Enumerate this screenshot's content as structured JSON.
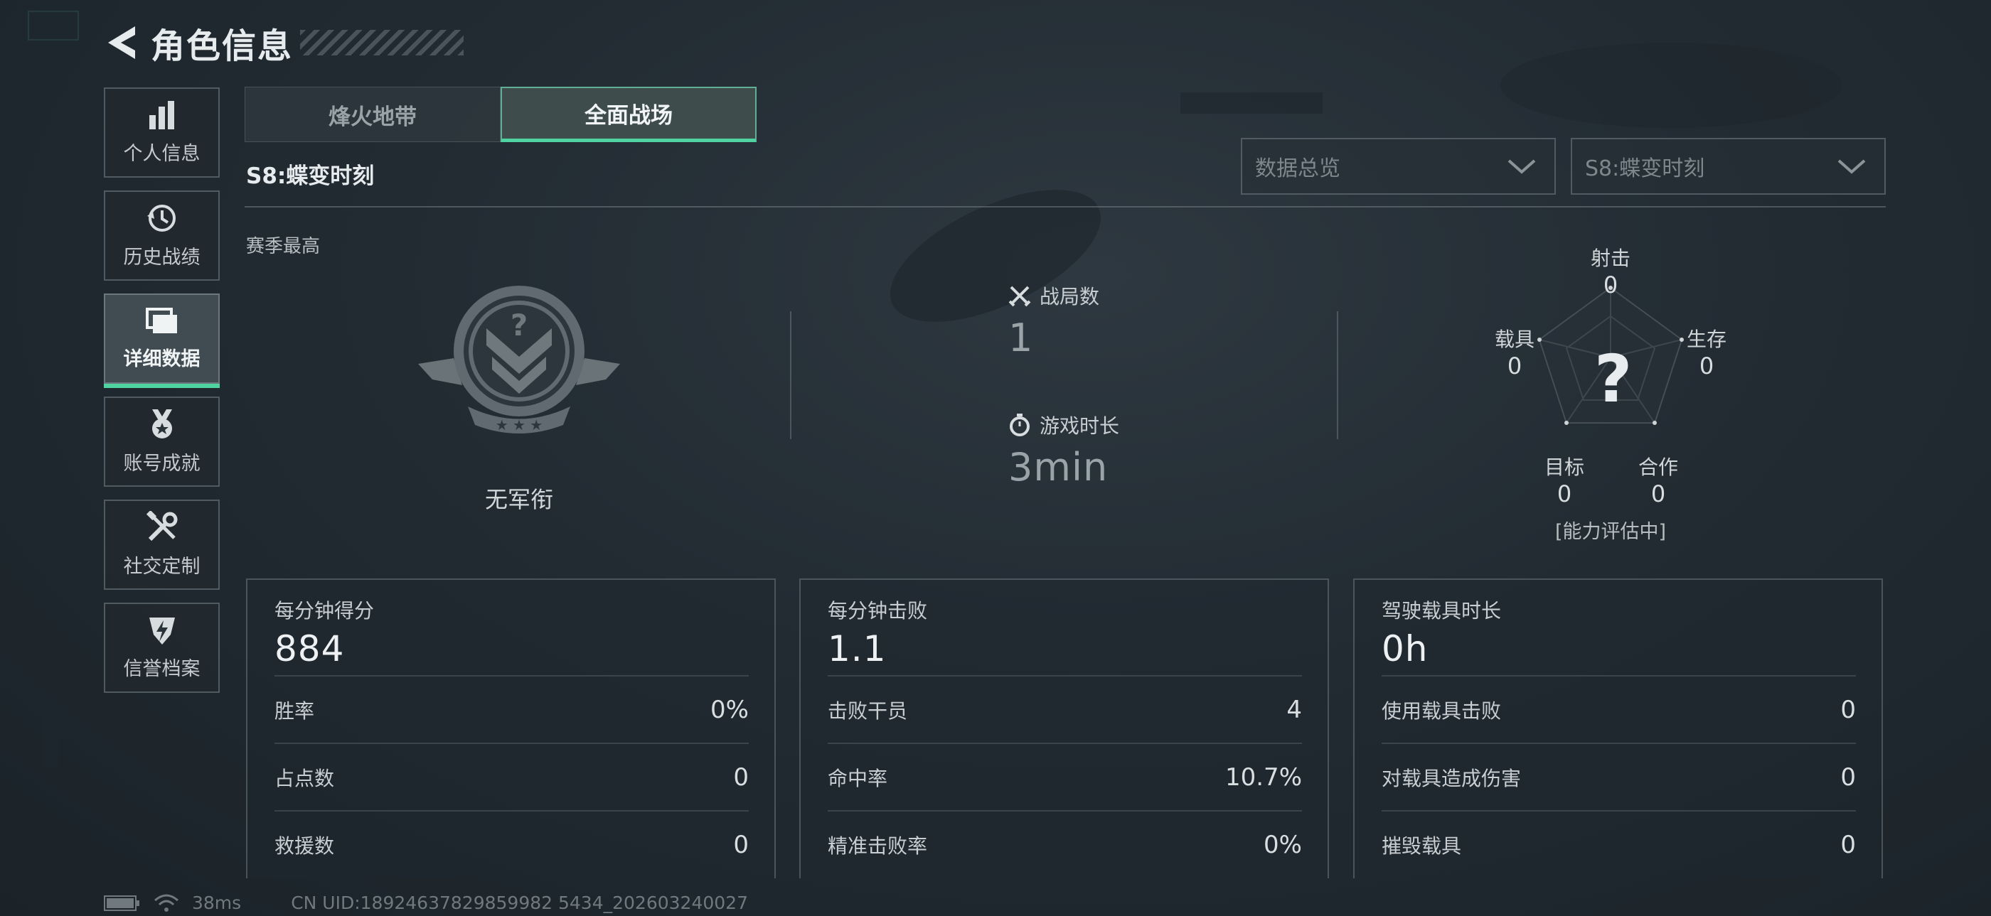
{
  "header": {
    "title": "角色信息"
  },
  "sidebar": {
    "items": [
      {
        "label": "个人信息",
        "icon": "bar-chart-icon"
      },
      {
        "label": "历史战绩",
        "icon": "history-clock-icon"
      },
      {
        "label": "详细数据",
        "icon": "folder-data-icon",
        "active": true
      },
      {
        "label": "账号成就",
        "icon": "medal-icon"
      },
      {
        "label": "社交定制",
        "icon": "tools-icon"
      },
      {
        "label": "信誉档案",
        "icon": "shield-lightning-icon"
      }
    ]
  },
  "tabs": [
    {
      "label": "烽火地带",
      "active": false
    },
    {
      "label": "全面战场",
      "active": true
    }
  ],
  "season": {
    "title": "S8:蝶变时刻"
  },
  "filters": {
    "view_placeholder": "数据总览",
    "season_placeholder": "S8:蝶变时刻"
  },
  "summary": {
    "section_label": "赛季最高",
    "rank_name": "无军衔",
    "matches_label": "战局数",
    "matches_value": "1",
    "playtime_label": "游戏时长",
    "playtime_value": "3min"
  },
  "radar": {
    "center_mark": "?",
    "axes": [
      {
        "label": "射击",
        "value": "0"
      },
      {
        "label": "生存",
        "value": "0"
      },
      {
        "label": "合作",
        "value": "0"
      },
      {
        "label": "目标",
        "value": "0"
      },
      {
        "label": "载具",
        "value": "0"
      }
    ],
    "caption": "[能力评估中]"
  },
  "panels": [
    {
      "label": "每分钟得分",
      "value": "884",
      "rows": [
        {
          "label": "胜率",
          "value": "0%"
        },
        {
          "label": "占点数",
          "value": "0"
        },
        {
          "label": "救援数",
          "value": "0"
        }
      ]
    },
    {
      "label": "每分钟击败",
      "value": "1.1",
      "rows": [
        {
          "label": "击败干员",
          "value": "4"
        },
        {
          "label": "命中率",
          "value": "10.7%"
        },
        {
          "label": "精准击败率",
          "value": "0%"
        }
      ]
    },
    {
      "label": "驾驶载具时长",
      "value": "0h",
      "rows": [
        {
          "label": "使用载具击败",
          "value": "0"
        },
        {
          "label": "对载具造成伤害",
          "value": "0"
        },
        {
          "label": "摧毁载具",
          "value": "0"
        }
      ]
    }
  ],
  "status_bar": {
    "ping": "38ms",
    "uid": "CN UID:18924637829859982 5434_202603240027"
  },
  "colors": {
    "accent": "#4fd3a0",
    "background": "#222b32"
  }
}
